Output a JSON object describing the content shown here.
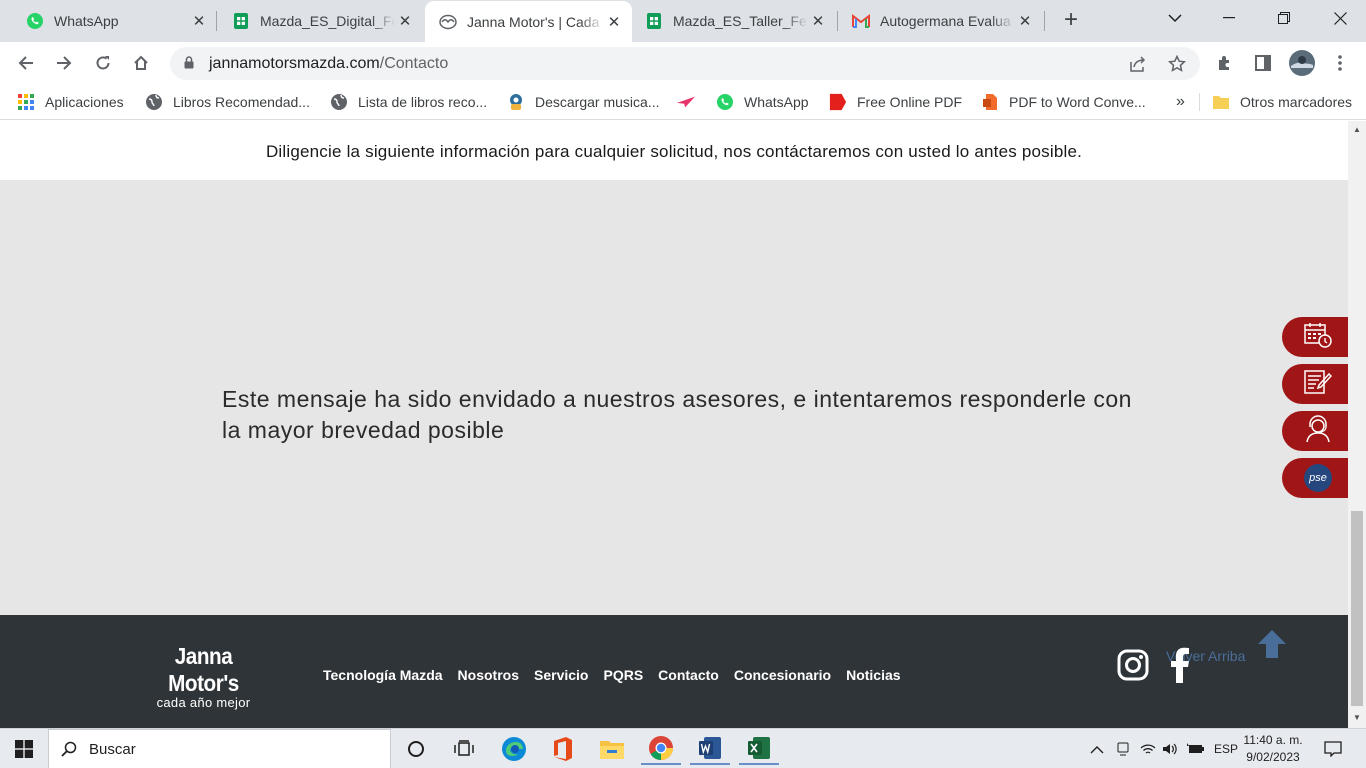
{
  "tabs": [
    {
      "title": "WhatsApp",
      "icon": "whatsapp-icon",
      "active": false
    },
    {
      "title": "Mazda_ES_Digital_Fe",
      "icon": "sheets-icon",
      "active": false
    },
    {
      "title": "Janna Motor's | Cada",
      "icon": "mazda-icon",
      "active": true
    },
    {
      "title": "Mazda_ES_Taller_Feb",
      "icon": "sheets-icon",
      "active": false
    },
    {
      "title": "Autogermana Evalua",
      "icon": "gmail-icon",
      "active": false
    }
  ],
  "address": {
    "host": "jannamotorsmazda.com",
    "path": "/Contacto"
  },
  "bookmarks": [
    {
      "label": "Aplicaciones",
      "icon": "apps-grid-icon"
    },
    {
      "label": "Libros Recomendad...",
      "icon": "globe-icon"
    },
    {
      "label": "Lista de libros reco...",
      "icon": "globe-icon"
    },
    {
      "label": "Descargar musica...",
      "icon": "music-download-icon"
    },
    {
      "label": "",
      "icon": "paper-plane-icon"
    },
    {
      "label": "WhatsApp",
      "icon": "whatsapp-icon"
    },
    {
      "label": "Free Online PDF",
      "icon": "pdf-icon"
    },
    {
      "label": "PDF to Word Conve...",
      "icon": "pdf-convert-icon"
    },
    {
      "label": "»",
      "icon": ""
    },
    {
      "label": "Otros marcadores",
      "icon": "folder-icon"
    }
  ],
  "page": {
    "intro": "Diligencie la siguiente información para cualquier solicitud, nos contáctaremos con usted lo antes posible.",
    "message": "Este mensaje ha sido envidado a nuestros asesores, e intentaremos responderle con la mayor brevedad posible"
  },
  "floating_buttons": [
    {
      "icon": "calendar-clock-icon"
    },
    {
      "icon": "form-edit-icon"
    },
    {
      "icon": "support-agent-icon"
    },
    {
      "icon": "pse-payment-icon",
      "label": "pse"
    }
  ],
  "footer": {
    "brand": "Janna Motor's",
    "tagline": "cada año mejor",
    "nav": [
      "Tecnología Mazda",
      "Nosotros",
      "Servicio",
      "PQRS",
      "Contacto",
      "Concesionario",
      "Noticias"
    ],
    "back_to_top": "Volver Arriba"
  },
  "taskbar": {
    "search_placeholder": "Buscar",
    "language": "ESP",
    "time": "11:40 a. m.",
    "date": "9/02/2023"
  },
  "colors": {
    "accent_red": "#a01515",
    "footer_bg": "#2f3438",
    "page_bg": "#e6e6e6"
  }
}
